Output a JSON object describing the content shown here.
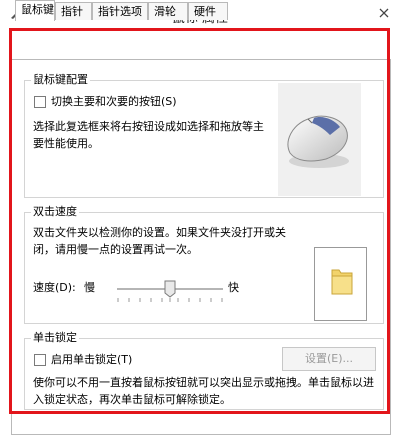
{
  "window": {
    "title": "鼠标 属性",
    "icon": "mouse-cursor-icon",
    "close_icon": "close-icon"
  },
  "tabs": [
    {
      "label": "鼠标键",
      "active": true
    },
    {
      "label": "指针",
      "active": false
    },
    {
      "label": "指针选项",
      "active": false
    },
    {
      "label": "滑轮",
      "active": false
    },
    {
      "label": "硬件",
      "active": false
    }
  ],
  "button_config": {
    "legend": "鼠标键配置",
    "switch_checkbox_label": "切换主要和次要的按钮(S)",
    "switch_checked": false,
    "description": "选择此复选框来将右按钮设成如选择和拖放等主要性能使用。",
    "illustration": "mouse-illustration"
  },
  "double_click": {
    "legend": "双击速度",
    "description": "双击文件夹以检测你的设置。如果文件夹没打开或关闭，请用慢一点的设置再试一次。",
    "speed_label": "速度(D):",
    "slow_label": "慢",
    "fast_label": "快",
    "speed_level": 0.5,
    "test_icon": "folder-icon"
  },
  "click_lock": {
    "legend": "单击锁定",
    "enable_label": "启用单击锁定(T)",
    "enabled": false,
    "settings_button": "设置(E)...",
    "description": "使你可以不用一直按着鼠标按钮就可以突出显示或拖拽。单击鼠标以进入锁定状态，再次单击鼠标可解除锁定。"
  },
  "colors": {
    "highlight_border": "#e2151b",
    "group_border": "#d4d4d4"
  }
}
